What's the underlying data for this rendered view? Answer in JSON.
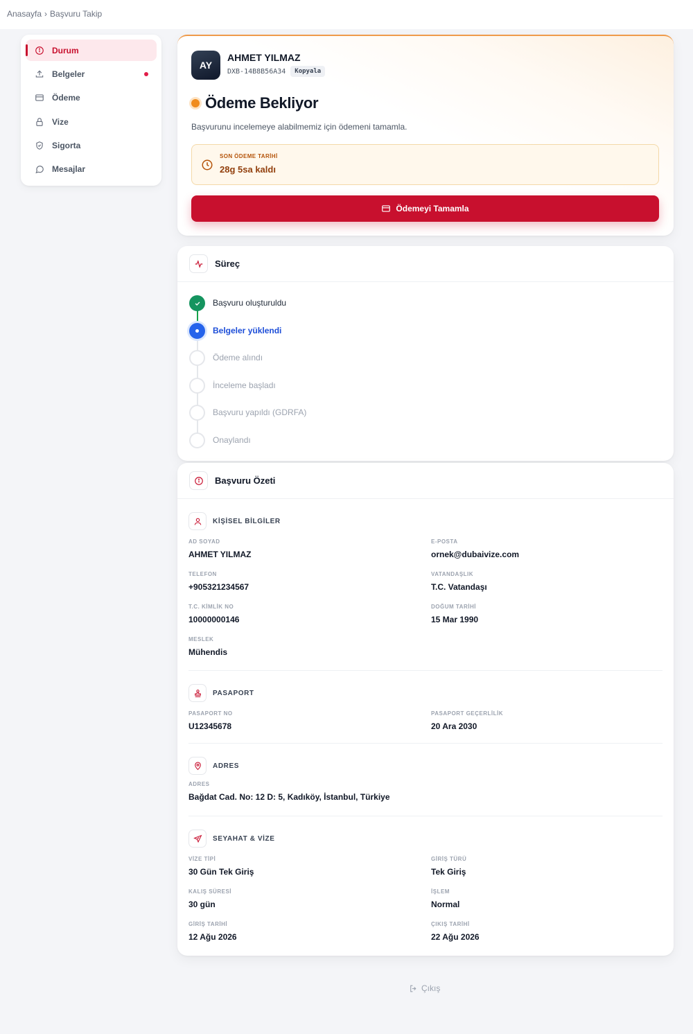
{
  "breadcrumb": {
    "home": "Anasayfa",
    "separator": "›",
    "current": "Başvuru Takip"
  },
  "sidebar": {
    "items": [
      {
        "label": "Durum",
        "icon": "info-icon",
        "active": true
      },
      {
        "label": "Belgeler",
        "icon": "upload-icon",
        "badge": true
      },
      {
        "label": "Ödeme",
        "icon": "credit-card-icon"
      },
      {
        "label": "Vize",
        "icon": "lock-icon"
      },
      {
        "label": "Sigorta",
        "icon": "shield-icon"
      },
      {
        "label": "Mesajlar",
        "icon": "message-icon"
      }
    ]
  },
  "status": {
    "avatar_initials": "AY",
    "name": "AHMET YILMAZ",
    "reference": "DXB-14B8B56A34",
    "copy_label": "Kopyala",
    "title": "Ödeme Bekliyor",
    "description": "Başvurunu incelemeye alabilmemiz için ödemeni tamamla.",
    "deadline_label": "SON ÖDEME TARİHİ",
    "deadline_value": "28g 5sa kaldı",
    "pay_button": "Ödemeyi Tamamla",
    "status_color": "#f08c1e"
  },
  "process": {
    "title": "Süreç",
    "steps": [
      {
        "label": "Başvuru oluşturuldu",
        "state": "done"
      },
      {
        "label": "Belgeler yüklendi",
        "state": "current"
      },
      {
        "label": "Ödeme alındı",
        "state": "pending"
      },
      {
        "label": "İnceleme başladı",
        "state": "pending"
      },
      {
        "label": "Başvuru yapıldı (GDRFA)",
        "state": "pending"
      },
      {
        "label": "Onaylandı",
        "state": "pending"
      }
    ]
  },
  "summary": {
    "title": "Başvuru Özeti",
    "personal": {
      "title": "KİŞİSEL BİLGİLER",
      "fields": [
        {
          "label": "AD SOYAD",
          "value": "AHMET YILMAZ"
        },
        {
          "label": "E-POSTA",
          "value": "ornek@dubaivize.com"
        },
        {
          "label": "TELEFON",
          "value": "+905321234567"
        },
        {
          "label": "VATANDAŞLIK",
          "value": "T.C. Vatandaşı"
        },
        {
          "label": "T.C. KİMLİK NO",
          "value": "10000000146"
        },
        {
          "label": "DOĞUM TARİHİ",
          "value": "15 Mar 1990"
        },
        {
          "label": "MESLEK",
          "value": "Mühendis"
        }
      ]
    },
    "passport": {
      "title": "PASAPORT",
      "fields": [
        {
          "label": "PASAPORT NO",
          "value": "U12345678"
        },
        {
          "label": "PASAPORT GEÇERLİLİK",
          "value": "20 Ara 2030"
        }
      ]
    },
    "address": {
      "title": "ADRES",
      "fields": [
        {
          "label": "ADRES",
          "value": "Bağdat Cad. No: 12 D: 5, Kadıköy, İstanbul, Türkiye"
        }
      ]
    },
    "travel": {
      "title": "SEYAHAT & VİZE",
      "fields": [
        {
          "label": "VİZE TİPİ",
          "value": "30 Gün Tek Giriş"
        },
        {
          "label": "GİRİŞ TÜRÜ",
          "value": "Tek Giriş"
        },
        {
          "label": "KALIŞ SÜRESİ",
          "value": "30 gün"
        },
        {
          "label": "İŞLEM",
          "value": "Normal"
        },
        {
          "label": "GİRİŞ TARİHİ",
          "value": "12 Ağu 2026"
        },
        {
          "label": "ÇIKIŞ TARİHİ",
          "value": "22 Ağu 2026"
        }
      ]
    }
  },
  "logout_label": "Çıkış"
}
